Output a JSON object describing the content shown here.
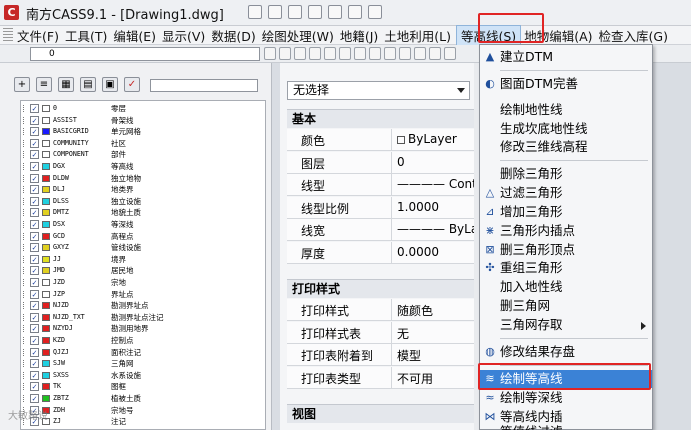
{
  "window": {
    "app_title": "南方CASS9.1 - [Drawing1.dwg]",
    "logo_letter": "C"
  },
  "menubar": {
    "items": [
      "文件(F)",
      "工具(T)",
      "编辑(E)",
      "显示(V)",
      "数据(D)",
      "绘图处理(W)",
      "地籍(J)",
      "土地利用(L)",
      "等高线(S)",
      "地物编辑(A)",
      "检查入库(G)"
    ],
    "active_item": "等高线(S)"
  },
  "toolbar": {
    "layer_value": "0"
  },
  "layer_panel": {
    "layers": [
      {
        "name": "0",
        "desc": "零层",
        "color": "#ffffff"
      },
      {
        "name": "ASSIST",
        "desc": "骨架线",
        "color": "#ffffff"
      },
      {
        "name": "BASICGRID",
        "desc": "单元网格",
        "color": "#1a1aff"
      },
      {
        "name": "COMMUNITY",
        "desc": "社区",
        "color": "#ffffff"
      },
      {
        "name": "COMPONENT",
        "desc": "部件",
        "color": "#ffffff"
      },
      {
        "name": "DGX",
        "desc": "等高线",
        "color": "#20d0e0"
      },
      {
        "name": "DLDW",
        "desc": "独立地物",
        "color": "#e02020"
      },
      {
        "name": "DLJ",
        "desc": "地类界",
        "color": "#e0d020"
      },
      {
        "name": "DLSS",
        "desc": "独立设施",
        "color": "#20d0e0"
      },
      {
        "name": "DMTZ",
        "desc": "地貌土质",
        "color": "#e0d020"
      },
      {
        "name": "DSX",
        "desc": "等深线",
        "color": "#20d0e0"
      },
      {
        "name": "GCD",
        "desc": "高程点",
        "color": "#e02020"
      },
      {
        "name": "GXYZ",
        "desc": "管线设施",
        "color": "#e0d020"
      },
      {
        "name": "JJ",
        "desc": "境界",
        "color": "#e0e020"
      },
      {
        "name": "JMD",
        "desc": "居民地",
        "color": "#e0d020"
      },
      {
        "name": "JZD",
        "desc": "宗地",
        "color": "#ffffff"
      },
      {
        "name": "JZP",
        "desc": "界址点",
        "color": "#ffffff"
      },
      {
        "name": "NJZD",
        "desc": "勘测界址点",
        "color": "#e02020"
      },
      {
        "name": "NJZD_TXT",
        "desc": "勘测界址点注记",
        "color": "#e02020"
      },
      {
        "name": "NZYDJ",
        "desc": "勘测用地界",
        "color": "#e02020"
      },
      {
        "name": "KZD",
        "desc": "控制点",
        "color": "#e02020"
      },
      {
        "name": "QJZJ",
        "desc": "面积注记",
        "color": "#e02020"
      },
      {
        "name": "SJW",
        "desc": "三角网",
        "color": "#20d0e0"
      },
      {
        "name": "SXSS",
        "desc": "水系设施",
        "color": "#20d0e0"
      },
      {
        "name": "TK",
        "desc": "图框",
        "color": "#e02020"
      },
      {
        "name": "ZBTZ",
        "desc": "植被土质",
        "color": "#20c020"
      },
      {
        "name": "ZDH",
        "desc": "宗地号",
        "color": "#e02020"
      },
      {
        "name": "ZJ",
        "desc": "注记",
        "color": "#ffffff"
      }
    ]
  },
  "properties": {
    "selection": "无选择",
    "section_basic": "基本",
    "basic_rows": [
      {
        "label": "颜色",
        "value": "ByLayer"
      },
      {
        "label": "图层",
        "value": "0"
      },
      {
        "label": "线型",
        "value": "———— Contin"
      },
      {
        "label": "线型比例",
        "value": "1.0000"
      },
      {
        "label": "线宽",
        "value": "———— ByLaye"
      },
      {
        "label": "厚度",
        "value": "0.0000"
      }
    ],
    "section_print": "打印样式",
    "print_rows": [
      {
        "label": "打印样式",
        "value": "随颜色"
      },
      {
        "label": "打印样式表",
        "value": "无"
      },
      {
        "label": "打印表附着到",
        "value": "模型"
      },
      {
        "label": "打印表类型",
        "value": "不可用"
      }
    ],
    "section_view": "视图"
  },
  "dropdown": {
    "items": [
      {
        "label": "建立DTM",
        "icon": "dtm-icon",
        "glyph": "▲"
      },
      {
        "label": "图面DTM完善",
        "icon": "dtm-refine-icon",
        "glyph": "◐"
      },
      {
        "label": "绘制地性线",
        "icon": "",
        "glyph": ""
      },
      {
        "label": "生成坎底地性线",
        "icon": "",
        "glyph": ""
      },
      {
        "label": "修改三维线高程",
        "icon": "",
        "glyph": ""
      },
      {
        "label": "删除三角形",
        "icon": "",
        "glyph": ""
      },
      {
        "label": "过滤三角形",
        "icon": "filter-triangle-icon",
        "glyph": "△"
      },
      {
        "label": "增加三角形",
        "icon": "add-triangle-icon",
        "glyph": "⊿"
      },
      {
        "label": "三角形内插点",
        "icon": "insert-point-icon",
        "glyph": "⋇"
      },
      {
        "label": "删三角形顶点",
        "icon": "delete-vertex-icon",
        "glyph": "⊠"
      },
      {
        "label": "重组三角形",
        "icon": "rebuild-triangle-icon",
        "glyph": "✣"
      },
      {
        "label": "加入地性线",
        "icon": "",
        "glyph": ""
      },
      {
        "label": "删三角网",
        "icon": "",
        "glyph": ""
      },
      {
        "label": "三角网存取",
        "icon": "",
        "glyph": ""
      },
      {
        "label": "修改结果存盘",
        "icon": "save-result-icon",
        "glyph": "◍"
      },
      {
        "label": "绘制等高线",
        "icon": "contour-icon",
        "glyph": "≋"
      },
      {
        "label": "绘制等深线",
        "icon": "isobath-icon",
        "glyph": "≈"
      },
      {
        "label": "等高线内插",
        "icon": "contour-interp-icon",
        "glyph": "⋈"
      },
      {
        "label": "等值线过滤",
        "icon": "contour-filter-icon",
        "glyph": "⋯"
      }
    ],
    "selected_item": "绘制等高线",
    "submenu_item": "三角网存取"
  },
  "watermark": "大敏路说",
  "colors": {
    "highlight_red": "#e02424",
    "menu_select": "#3b82d6"
  }
}
